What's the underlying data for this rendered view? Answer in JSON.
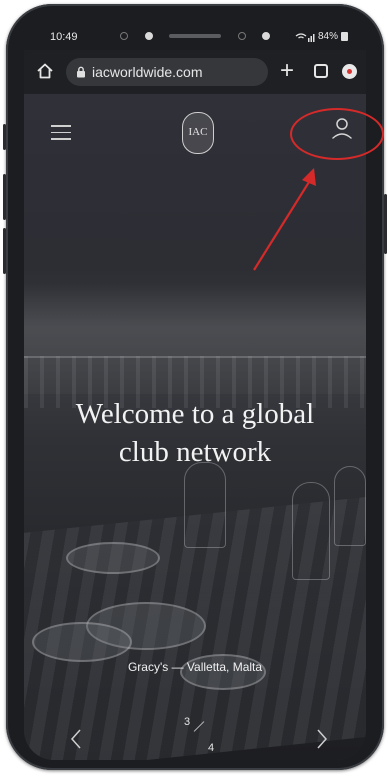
{
  "status_bar": {
    "time": "10:49",
    "battery": "84%"
  },
  "browser": {
    "url": "iacworldwide.com",
    "tab_count": ""
  },
  "site": {
    "logo_text": "IAC"
  },
  "hero": {
    "headline_line1": "Welcome to a global",
    "headline_line2": "club network",
    "caption": "Gracy's — Valletta, Malta",
    "slide_current": "3",
    "slide_total": "4"
  },
  "annotation": {
    "color": "#d42a2a"
  },
  "icons": [
    "home-icon",
    "lock-icon",
    "plus-icon",
    "tabs-icon",
    "browser-menu-icon",
    "hamburger-menu-icon",
    "account-icon",
    "chevron-left-icon",
    "chevron-right-icon"
  ]
}
